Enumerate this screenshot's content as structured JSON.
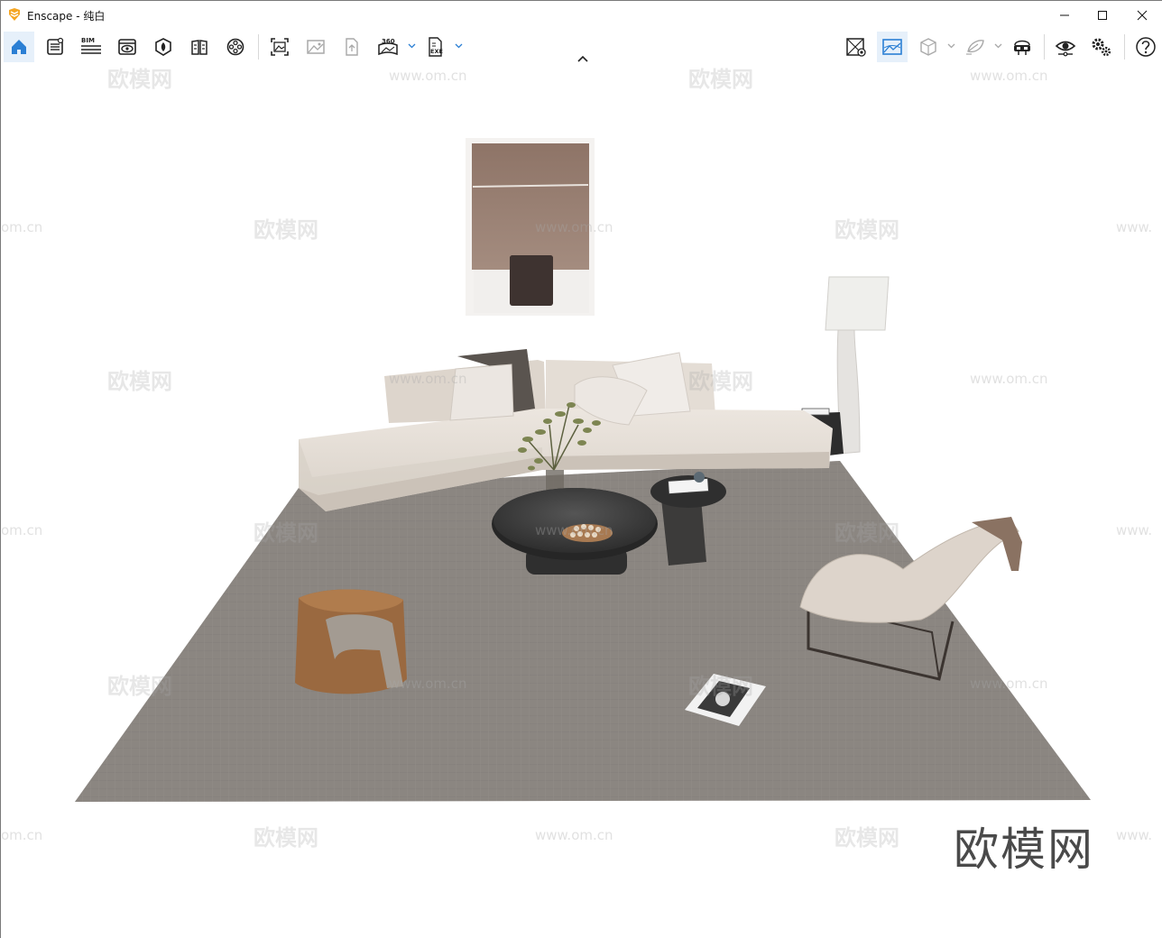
{
  "window": {
    "title": "Enscape - 纯白"
  },
  "toolbar": {
    "left_buttons": [
      {
        "name": "home-icon",
        "active": true
      },
      {
        "name": "settings-panel-icon"
      },
      {
        "name": "bim-icon",
        "label": "BIM"
      },
      {
        "name": "views-icon"
      },
      {
        "name": "asset-library-icon"
      },
      {
        "name": "material-editor-icon"
      },
      {
        "name": "video-editor-icon"
      }
    ],
    "export_buttons": [
      {
        "name": "screenshot-icon"
      },
      {
        "name": "batch-render-icon"
      },
      {
        "name": "upload-icon"
      },
      {
        "name": "panorama-icon",
        "label": "360"
      },
      {
        "name": "exe-export-icon",
        "label": "EXE"
      }
    ],
    "right_buttons": [
      {
        "name": "sync-views-icon"
      },
      {
        "name": "capture-icon",
        "active": true
      },
      {
        "name": "orthographic-icon"
      },
      {
        "name": "walk-mode-icon"
      },
      {
        "name": "vr-headset-icon"
      },
      {
        "name": "visual-settings-icon"
      },
      {
        "name": "general-settings-icon"
      },
      {
        "name": "help-icon",
        "label": "?"
      }
    ],
    "accent_color": "#2b7fd4"
  },
  "viewport": {
    "watermark_text": "欧模网",
    "watermark_url": "www.om.cn",
    "watermark_url_short": "om.cn",
    "watermark_url_cut": "www.",
    "brand_watermark": "欧模网"
  }
}
